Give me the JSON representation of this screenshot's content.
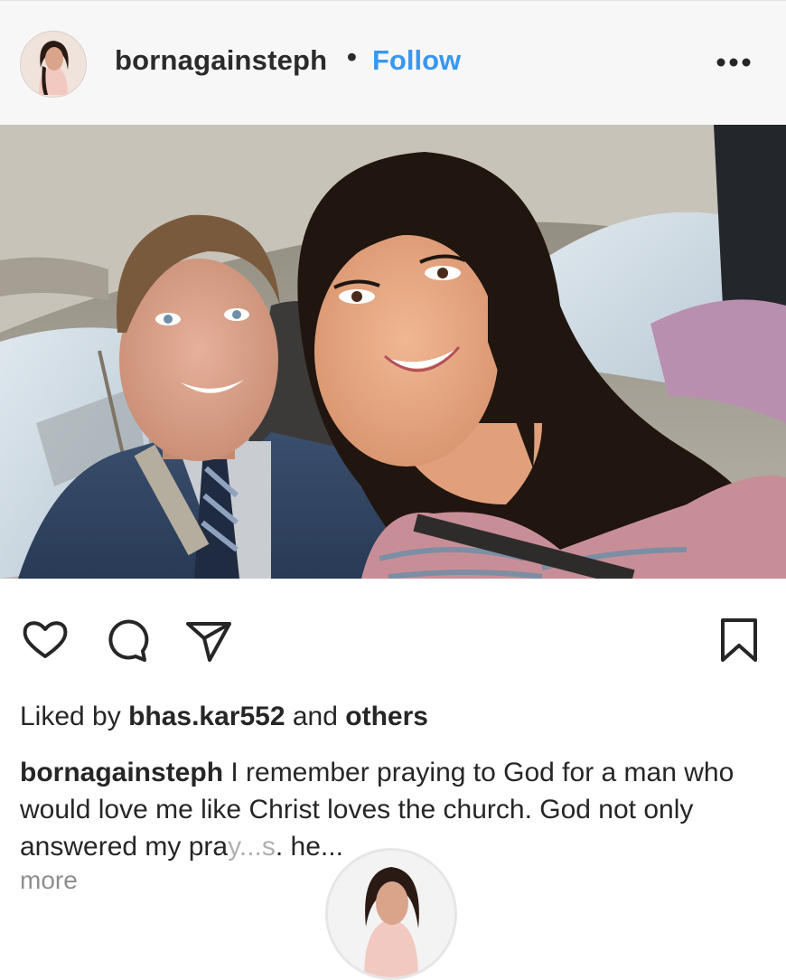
{
  "post": {
    "username": "bornagainsteph",
    "separator": "•",
    "follow_label": "Follow",
    "more_options_icon": "more-horizontal-icon",
    "photo_alt": "Selfie of a smiling couple in a car"
  },
  "actions": {
    "like_icon": "heart-icon",
    "comment_icon": "comment-icon",
    "share_icon": "paper-plane-icon",
    "save_icon": "bookmark-icon"
  },
  "likes": {
    "prefix": "Liked by ",
    "user": "bhas.kar552",
    "middle": " and ",
    "others": "others"
  },
  "caption": {
    "username": "bornagainsteph",
    "text": " I remember praying to God for a man who would love me like Christ loves the church. God not only answered my pra",
    "obscured": "y...s",
    "text_end": ". he...",
    "more_label": "more"
  },
  "colors": {
    "link_blue": "#3897f0",
    "text_dark": "#262626",
    "muted_gray": "#8e8e8e",
    "header_bg": "#f7f7f7"
  }
}
